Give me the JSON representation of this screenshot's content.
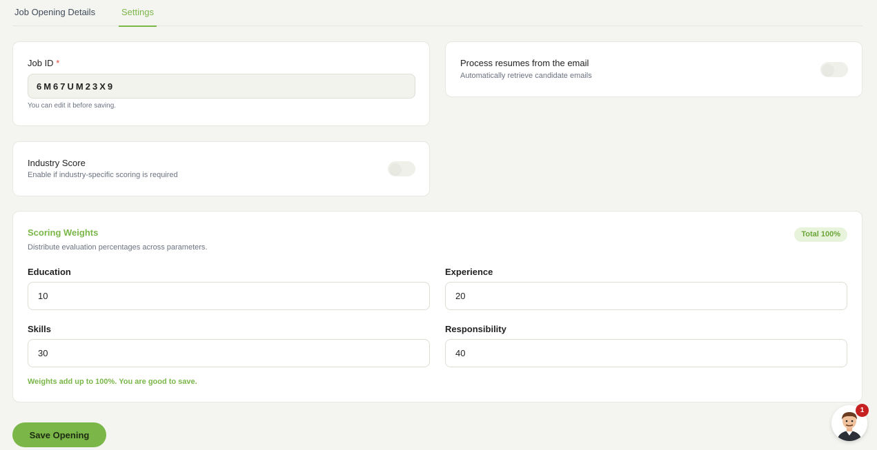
{
  "tabs": [
    {
      "label": "Job Opening Details",
      "active": false
    },
    {
      "label": "Settings",
      "active": true
    }
  ],
  "job_id": {
    "label": "Job ID",
    "required_mark": "*",
    "value": "6M67UM23X9",
    "hint": "You can edit it before saving."
  },
  "process_email": {
    "title": "Process resumes from the email",
    "subtitle": "Automatically retrieve candidate emails",
    "enabled": false
  },
  "industry_score": {
    "title": "Industry Score",
    "subtitle": "Enable if industry-specific scoring is required",
    "enabled": false
  },
  "scoring_weights": {
    "title": "Scoring Weights",
    "subtitle": "Distribute evaluation percentages across parameters.",
    "total_badge": "Total 100%",
    "fields": {
      "education": {
        "label": "Education",
        "value": "10"
      },
      "experience": {
        "label": "Experience",
        "value": "20"
      },
      "skills": {
        "label": "Skills",
        "value": "30"
      },
      "responsibility": {
        "label": "Responsibility",
        "value": "40"
      }
    },
    "status_message": "Weights add up to 100%. You are good to save."
  },
  "save_button": {
    "label": "Save Opening"
  },
  "assistant": {
    "notification_count": "1",
    "icon": "assistant-avatar-icon"
  },
  "colors": {
    "accent": "#7ab648",
    "background": "#f4f5f0",
    "badge": "#c62020"
  }
}
